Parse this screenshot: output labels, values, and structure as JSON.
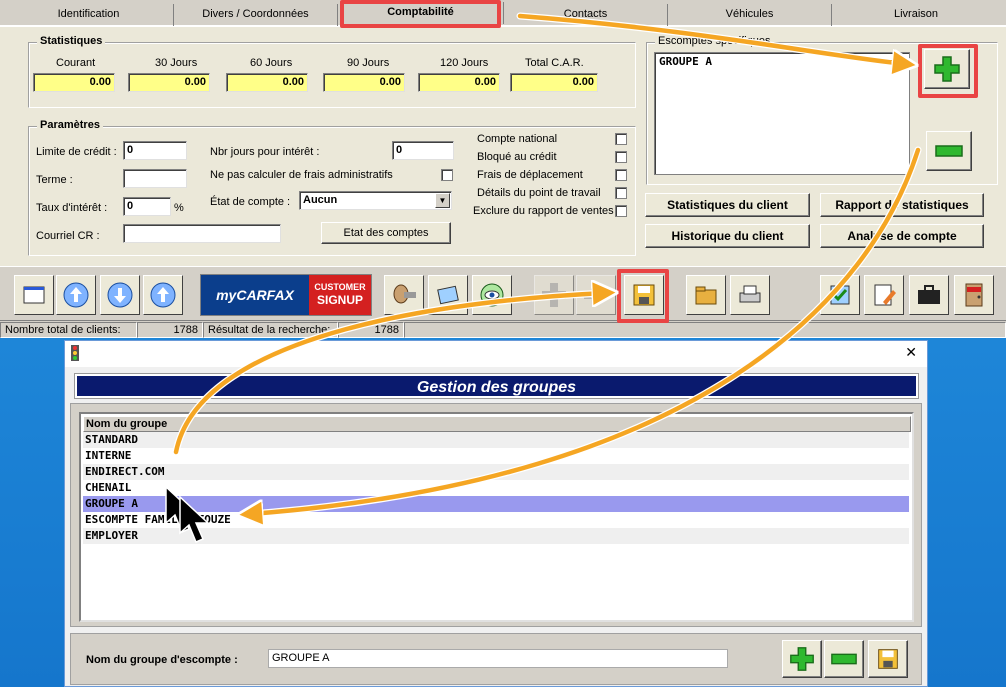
{
  "tabs": [
    "Identification",
    "Divers / Coordonnées",
    "Comptabilité",
    "Contacts",
    "Véhicules",
    "Livraison"
  ],
  "stats": {
    "title": "Statistiques",
    "cols": [
      {
        "label": "Courant",
        "value": "0.00"
      },
      {
        "label": "30 Jours",
        "value": "0.00"
      },
      {
        "label": "60 Jours",
        "value": "0.00"
      },
      {
        "label": "90 Jours",
        "value": "0.00"
      },
      {
        "label": "120 Jours",
        "value": "0.00"
      },
      {
        "label": "Total C.A.R.",
        "value": "0.00"
      }
    ]
  },
  "params": {
    "title": "Paramètres",
    "credit_limit_label": "Limite de crédit :",
    "credit_limit_value": "0",
    "term_label": "Terme :",
    "term_value": "",
    "interest_rate_label": "Taux d'intérêt :",
    "interest_rate_value": "0",
    "percent": "%",
    "email_label": "Courriel CR :",
    "email_value": "",
    "interest_days_label": "Nbr jours pour intérêt :",
    "interest_days_value": "0",
    "no_admin_fees_label": "Ne pas calculer de frais administratifs",
    "account_state_label": "État de compte :",
    "account_state_value": "Aucun",
    "account_states_button": "Etat des comptes",
    "checks": [
      "Compte national",
      "Bloqué au crédit",
      "Frais de déplacement",
      "Détails du point de travail",
      "Exclure du rapport de ventes"
    ]
  },
  "discounts": {
    "title": "Escomptes spécifiques",
    "items": [
      "GROUPE A"
    ]
  },
  "buttons": {
    "client_stats": "Statistiques du client",
    "stats_report": "Rapport de statistiques",
    "client_history": "Historique du client",
    "account_analysis": "Analyse de compte"
  },
  "carfax": {
    "brand": "myCARFAX",
    "line1": "CUSTOMER",
    "line2": "SIGNUP"
  },
  "status": {
    "total_label": "Nombre total de clients:",
    "total_value": "1788",
    "result_label": "Résultat de la recherche:",
    "result_value": "1788"
  },
  "dialog": {
    "close": "✕",
    "header": "Gestion des groupes",
    "column": "Nom du groupe",
    "groups": [
      "STANDARD",
      "INTERNE",
      "ENDIRECT.COM",
      "CHENAIL",
      "GROUPE A",
      "ESCOMPTE FAMILLE TOUZE",
      "EMPLOYER"
    ],
    "selected_index": 4,
    "name_label": "Nom du groupe d'escompte :",
    "name_value": "GROUPE A"
  },
  "colors": {
    "highlight": "#e94444",
    "arrow": "#f5a623",
    "selection": "#9999ee",
    "header": "#0a1a6e"
  }
}
